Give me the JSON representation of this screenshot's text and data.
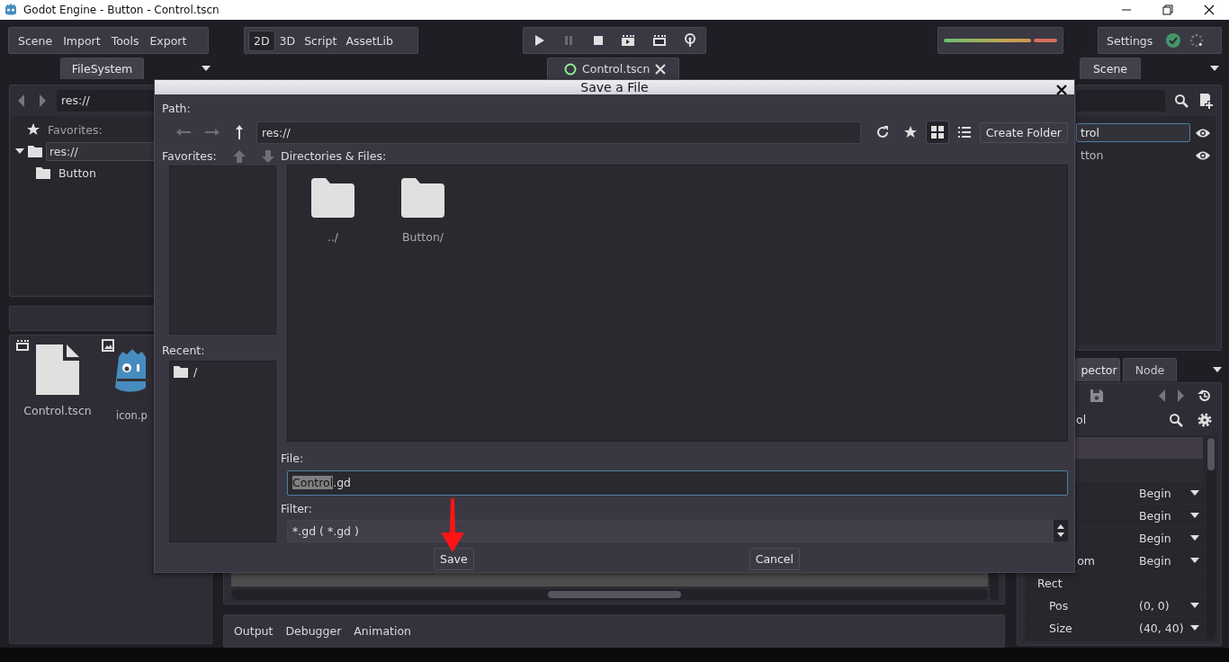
{
  "window": {
    "title": "Godot Engine - Button - Control.tscn"
  },
  "menu": [
    "Scene",
    "Import",
    "Tools",
    "Export"
  ],
  "workspaces": [
    {
      "label": "2D",
      "selected": true
    },
    {
      "label": "3D",
      "selected": false
    },
    {
      "label": "Script",
      "selected": false
    },
    {
      "label": "AssetLib",
      "selected": false
    }
  ],
  "settings": {
    "label": "Settings"
  },
  "left_dock": {
    "tabs": [
      {
        "label": "FileSystem",
        "selected": true
      }
    ],
    "path": "res://",
    "favorites_label": "Favorites:",
    "tree": [
      {
        "label": "res://",
        "selected": true,
        "expanded": true,
        "children": [
          {
            "label": "Button",
            "selected": false
          }
        ]
      }
    ],
    "files": [
      {
        "name": "Control.tscn",
        "kind": "scene"
      },
      {
        "name": "icon.p",
        "kind": "image"
      }
    ]
  },
  "scene_tabs": [
    {
      "label": "Control.tscn"
    }
  ],
  "scene_dock": {
    "tabs": [
      {
        "label": "Scene",
        "selected": true
      }
    ],
    "tree": [
      {
        "label": "trol",
        "selected": true
      },
      {
        "label": "tton",
        "selected": false
      }
    ]
  },
  "inspector": {
    "tabs": [
      {
        "label": "pector",
        "selected": true
      },
      {
        "label": "Node",
        "selected": false
      }
    ],
    "object": "ol",
    "properties": [
      {
        "kind": "category"
      },
      {
        "kind": "blank"
      },
      {
        "kind": "enum",
        "value": "Begin"
      },
      {
        "kind": "enum",
        "value": "Begin"
      },
      {
        "kind": "enum",
        "value": "Begin"
      },
      {
        "kind": "enum",
        "label": "om",
        "value": "Begin"
      },
      {
        "kind": "section",
        "label": "Rect"
      },
      {
        "kind": "vector",
        "label": "Pos",
        "value": "(0, 0)"
      },
      {
        "kind": "vector",
        "label": "Size",
        "value": "(40, 40)"
      }
    ]
  },
  "bottom_panel": {
    "tabs": [
      "Output",
      "Debugger",
      "Animation"
    ]
  },
  "dialog": {
    "title": "Save a File",
    "path_label": "Path:",
    "path": "res://",
    "view_buttons": [
      {
        "kind": "grid",
        "selected": true
      },
      {
        "kind": "list",
        "selected": false
      }
    ],
    "create_folder": "Create Folder",
    "favorites_label": "Favorites:",
    "recent_label": "Recent:",
    "recent": [
      {
        "label": "/"
      }
    ],
    "files_label": "Directories & Files:",
    "entries": [
      {
        "name": "../"
      },
      {
        "name": "Button/"
      }
    ],
    "file_label": "File:",
    "file_name": {
      "selected": "Control",
      "rest": ".gd"
    },
    "filter_label": "Filter:",
    "filter": "*.gd ( *.gd )",
    "buttons": [
      "Save",
      "Cancel"
    ]
  }
}
